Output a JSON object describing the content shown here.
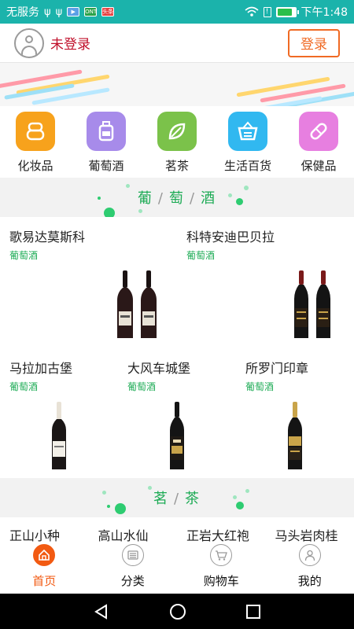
{
  "status_bar": {
    "carrier": "无服务",
    "app_badge_1": "ONT",
    "app_badge_2": "头条",
    "time": "下午1:48",
    "battery_level": 0.85
  },
  "header": {
    "login_status": "未登录",
    "login_button": "登录"
  },
  "categories": [
    {
      "label": "化妆品",
      "icon": "cosmetics-icon",
      "color": "#f7a21c"
    },
    {
      "label": "葡萄酒",
      "icon": "wine-icon",
      "color": "#a78bea"
    },
    {
      "label": "茗茶",
      "icon": "tea-leaf-icon",
      "color": "#7bc24a"
    },
    {
      "label": "生活百货",
      "icon": "shopping-basket-icon",
      "color": "#31b8f0"
    },
    {
      "label": "保健品",
      "icon": "capsule-icon",
      "color": "#e77fe0"
    }
  ],
  "wine_section": {
    "title_parts": [
      "葡",
      "萄",
      "酒"
    ],
    "separator": "/",
    "products": [
      {
        "name": "歌易达莫斯科",
        "tag": "葡萄酒"
      },
      {
        "name": "科特安迪巴贝拉",
        "tag": "葡萄酒"
      },
      {
        "name": "马拉加古堡",
        "tag": "葡萄酒"
      },
      {
        "name": "大风车城堡",
        "tag": "葡萄酒"
      },
      {
        "name": "所罗门印章",
        "tag": "葡萄酒"
      }
    ]
  },
  "tea_section": {
    "title_parts": [
      "茗",
      "茶"
    ],
    "separator": "/",
    "items": [
      "正山小种",
      "高山水仙",
      "正岩大红袍",
      "马头岩肉桂"
    ]
  },
  "tab_bar": {
    "tabs": [
      {
        "label": "首页",
        "icon": "home-icon",
        "active": true
      },
      {
        "label": "分类",
        "icon": "list-icon",
        "active": false
      },
      {
        "label": "购物车",
        "icon": "cart-icon",
        "active": false
      },
      {
        "label": "我的",
        "icon": "user-icon",
        "active": false
      }
    ]
  },
  "colors": {
    "status_bar": "#1bb3ab",
    "accent_orange": "#f25a12",
    "green": "#1dab55",
    "login_red": "#c00f2a"
  }
}
